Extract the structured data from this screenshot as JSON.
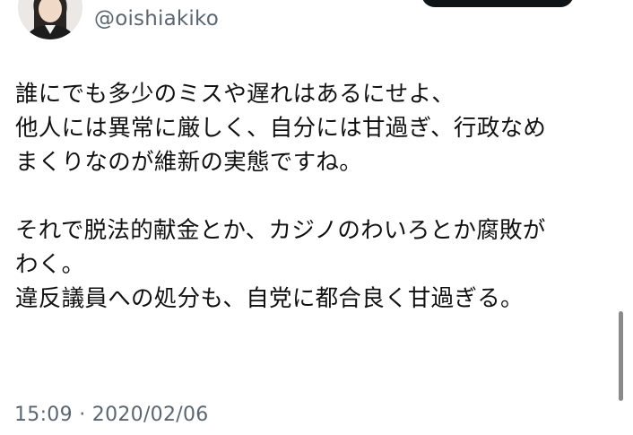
{
  "profile": {
    "handle": "@oishiakiko"
  },
  "tweet": {
    "lines": [
      "誰にでも多少のミスや遅れはあるにせよ、",
      "他人には異常に厳しく、自分には甘過ぎ、行政なめ",
      "まくりなのが維新の実態ですね。",
      "",
      "それで脱法的献金とか、カジノのわいろとか腐敗が",
      "わく。",
      "違反議員への処分も、自党に都合良く甘過ぎる。"
    ],
    "timestamp": "15:09 · 2020/02/06"
  },
  "colors": {
    "text": "#111111",
    "secondary_text": "#5b6670",
    "button": "#0f1419",
    "scrollbar": "#8a8a8a"
  }
}
